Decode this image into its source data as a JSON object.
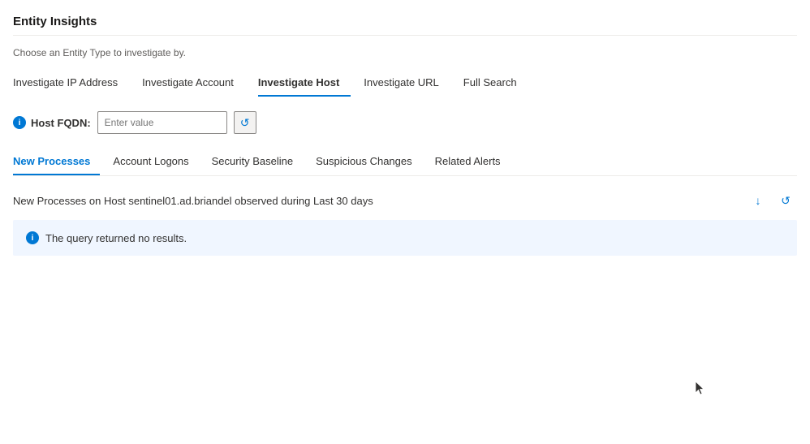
{
  "page": {
    "title": "Entity Insights",
    "subtitle": "Choose an Entity Type to investigate by."
  },
  "nav_tabs": [
    {
      "id": "investigate-ip",
      "label": "Investigate IP Address",
      "active": false
    },
    {
      "id": "investigate-account",
      "label": "Investigate Account",
      "active": false
    },
    {
      "id": "investigate-host",
      "label": "Investigate Host",
      "active": true
    },
    {
      "id": "investigate-url",
      "label": "Investigate URL",
      "active": false
    },
    {
      "id": "full-search",
      "label": "Full Search",
      "active": false
    }
  ],
  "input_section": {
    "label": "Host FQDN:",
    "placeholder": "Enter value"
  },
  "sub_tabs": [
    {
      "id": "new-processes",
      "label": "New Processes",
      "active": true
    },
    {
      "id": "account-logons",
      "label": "Account Logons",
      "active": false
    },
    {
      "id": "security-baseline",
      "label": "Security Baseline",
      "active": false
    },
    {
      "id": "suspicious-changes",
      "label": "Suspicious Changes",
      "active": false
    },
    {
      "id": "related-alerts",
      "label": "Related Alerts",
      "active": false
    }
  ],
  "results": {
    "title": "New Processes on Host sentinel01.ad.briandel observed during Last 30 days",
    "no_results_text": "The query returned no results."
  },
  "icons": {
    "info": "i",
    "download": "↓",
    "refresh": "↺"
  }
}
